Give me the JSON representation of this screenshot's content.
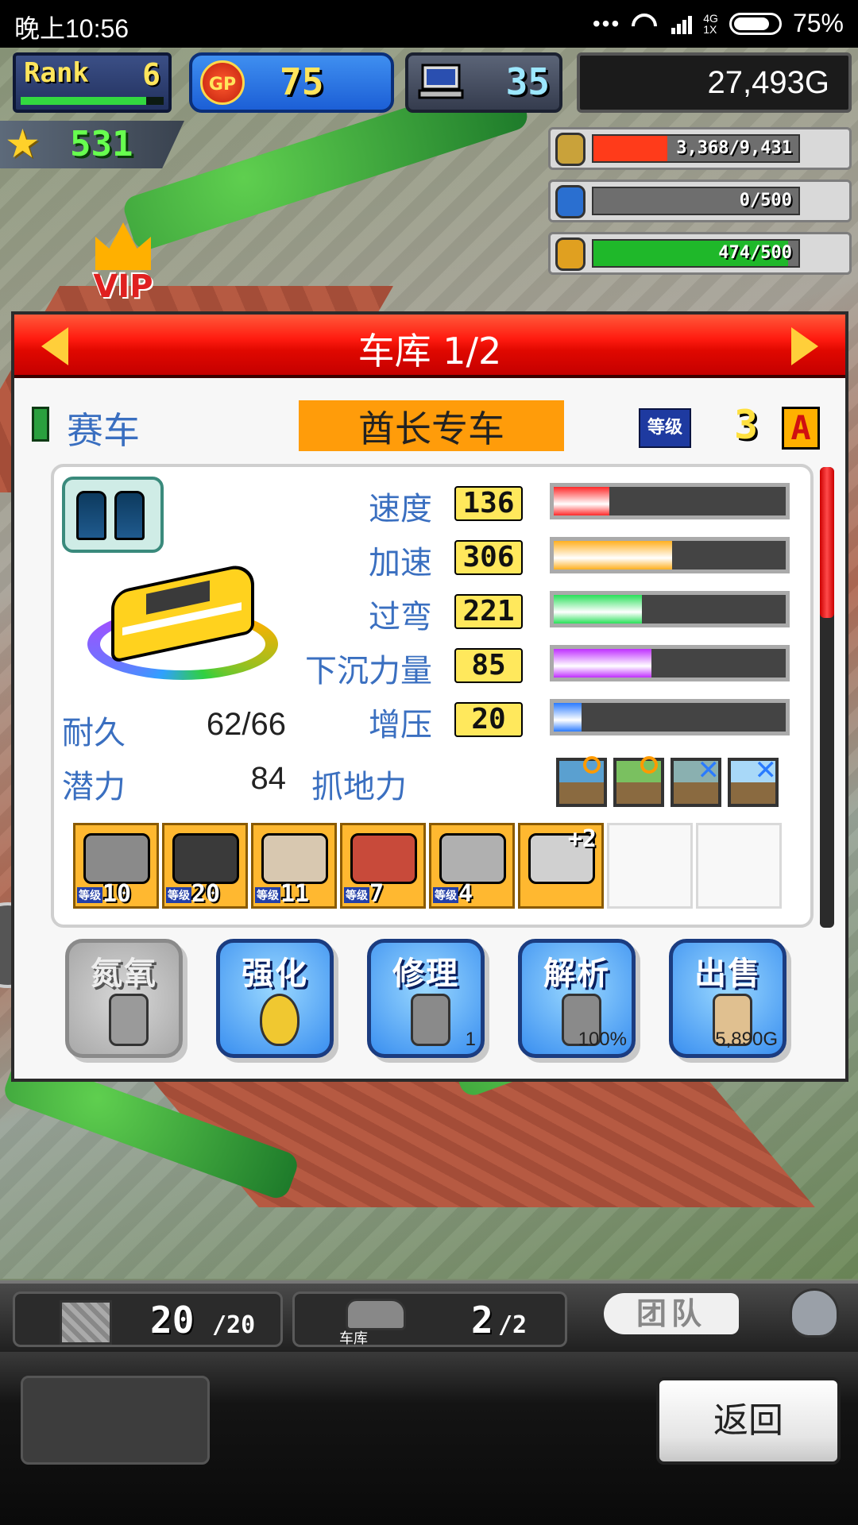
{
  "status_bar": {
    "time": "晚上10:56",
    "network": "4G\n1X",
    "battery": "75%"
  },
  "hud": {
    "rank_label": "Rank",
    "rank_value": "6",
    "rank_progress": 0.88,
    "gp_label": "GP",
    "gp_value": "75",
    "pc_value": "35",
    "money": "27,493G",
    "stars": "531"
  },
  "resources": [
    {
      "icon": "coin-stack-icon",
      "text": "3,368/9,431",
      "fill": 0.36,
      "color": "#ff3b1a"
    },
    {
      "icon": "fuel-bottle-icon",
      "text": "0/500",
      "fill": 0.0,
      "color": "#3a8ff0"
    },
    {
      "icon": "wheat-icon",
      "text": "474/500",
      "fill": 0.95,
      "color": "#1fb82a"
    }
  ],
  "vip_label": "VIP",
  "dialog": {
    "title": "车库 1/2",
    "class_label": "赛车",
    "car_name": "酋长专车",
    "level_tag": "等级",
    "level": "3",
    "grade": "A"
  },
  "stats": [
    {
      "label": "速度",
      "value": "136",
      "fill": 0.24,
      "color": "#ff2a2a"
    },
    {
      "label": "加速",
      "value": "306",
      "fill": 0.51,
      "color": "#ffb020"
    },
    {
      "label": "过弯",
      "value": "221",
      "fill": 0.38,
      "color": "#2ae05a"
    },
    {
      "label": "下沉力量",
      "value": "85",
      "fill": 0.42,
      "color": "#c030ff"
    },
    {
      "label": "增压",
      "value": "20",
      "fill": 0.12,
      "color": "#2a7bff"
    }
  ],
  "info": {
    "durability_label": "耐久",
    "durability_value": "62/66",
    "potential_label": "潜力",
    "potential_value": "84",
    "grip_label": "抓地力"
  },
  "terrain": [
    {
      "icon": "paved-road-icon",
      "bg": "#5aa0d0",
      "mark": "ok"
    },
    {
      "icon": "dirt-road-icon",
      "bg": "#7ac060",
      "mark": "ok"
    },
    {
      "icon": "rough-road-icon",
      "bg": "#8ab0b0",
      "mark": "x"
    },
    {
      "icon": "snow-road-icon",
      "bg": "#a8d8f8",
      "mark": "x"
    }
  ],
  "parts": [
    {
      "icon": "engine-icon",
      "level_tag": "等级",
      "level": "10"
    },
    {
      "icon": "tire-icon",
      "level_tag": "等级",
      "level": "20"
    },
    {
      "icon": "wheel-icon",
      "level_tag": "等级",
      "level": "11"
    },
    {
      "icon": "brake-icon",
      "level_tag": "等级",
      "level": "7"
    },
    {
      "icon": "spoiler-icon",
      "level_tag": "等级",
      "level": "4"
    },
    {
      "icon": "frame-icon",
      "plus": "+2"
    }
  ],
  "actions": [
    {
      "label": "氮氧",
      "icon": "nitro-bottle-icon",
      "sub": "",
      "disabled": true
    },
    {
      "label": "强化",
      "icon": "golden-egg-icon",
      "sub": "",
      "disabled": false
    },
    {
      "label": "修理",
      "icon": "wrench-gear-icon",
      "sub": "1",
      "disabled": false
    },
    {
      "label": "解析",
      "icon": "analysis-computer-icon",
      "sub": "100%",
      "disabled": false
    },
    {
      "label": "出售",
      "icon": "money-bag-icon",
      "sub": "5,890G",
      "disabled": false
    }
  ],
  "bottom_bar": {
    "storage_count": "20",
    "storage_max": "/20",
    "garage_count": "2",
    "garage_max": "/2",
    "garage_caption": "车库",
    "team_label": "团队"
  },
  "footer": {
    "back_label": "返回"
  }
}
